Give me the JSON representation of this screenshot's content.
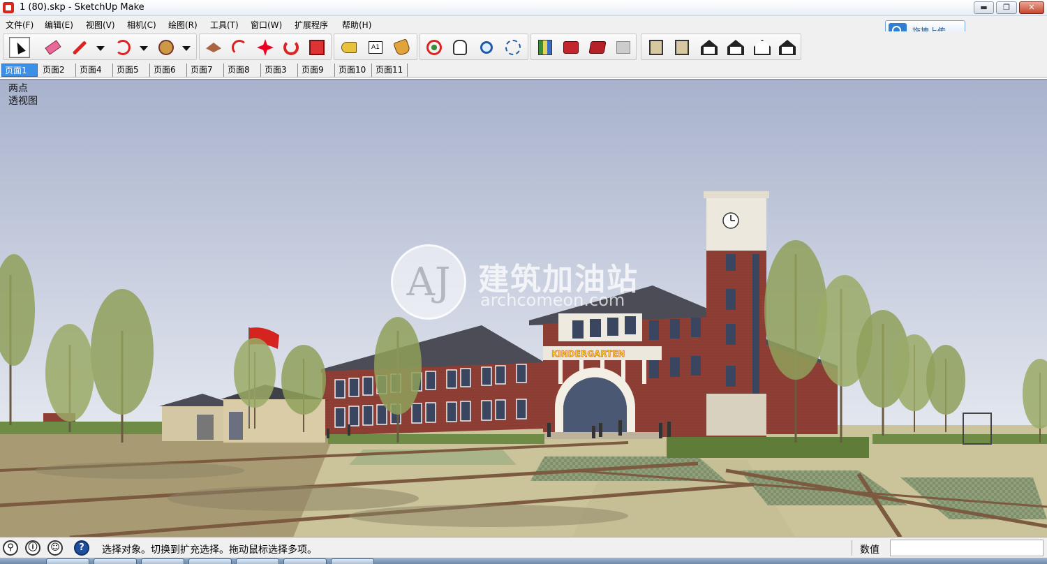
{
  "window": {
    "title": "1 (80).skp - SketchUp Make",
    "min_glyph": "▬",
    "max_glyph": "❐",
    "close_glyph": "✕"
  },
  "menu": {
    "items": [
      "文件(F)",
      "编辑(E)",
      "视图(V)",
      "相机(C)",
      "绘图(R)",
      "工具(T)",
      "窗口(W)",
      "扩展程序",
      "帮助(H)"
    ]
  },
  "upload": {
    "label": "拖拽上传",
    "icon": "cloud-upload-icon"
  },
  "toolbar": {
    "text_tool_glyph": "A1",
    "tools": [
      "select-icon",
      "eraser-icon",
      "pencil-icon",
      "arc-icon",
      "polygon-icon",
      "push-pull-icon",
      "follow-me-icon",
      "move-icon",
      "rotate-icon",
      "scale-icon",
      "tape-measure-icon",
      "text-icon",
      "paint-bucket-icon",
      "orbit-icon",
      "pan-icon",
      "zoom-icon",
      "zoom-extents-icon",
      "location-map-icon",
      "3d-warehouse-icon",
      "share-model-icon",
      "extension-warehouse-icon",
      "iso-view-icon",
      "front-view-icon",
      "top-view-icon",
      "right-view-icon",
      "back-view-icon",
      "left-view-icon"
    ]
  },
  "scenes": {
    "tabs": [
      "页面1",
      "页面2",
      "页面4",
      "页面5",
      "页面6",
      "页面7",
      "页面8",
      "页面3",
      "页面9",
      "页面10",
      "页面11"
    ],
    "active_index": 0
  },
  "viewport": {
    "camera_label_line1": "两点",
    "camera_label_line2": "透视图",
    "sign_text": "KINDERGARTEN",
    "watermark_logo": "AJ",
    "watermark_text": "建筑加油站",
    "watermark_sub": "archcomeon.com",
    "sky_color": "#b9c1d6",
    "brick_color": "#8e3f35",
    "roof_color": "#4b4c55",
    "grass_color": "#6f8c46"
  },
  "status": {
    "message": "选择对象。切换到扩充选择。拖动鼠标选择多项。",
    "measure_label": "数值",
    "measure_value": "",
    "geo_glyph": "⚲",
    "credits_glyph": "ⓘ",
    "user_glyph": "☺",
    "help_glyph": "?"
  }
}
